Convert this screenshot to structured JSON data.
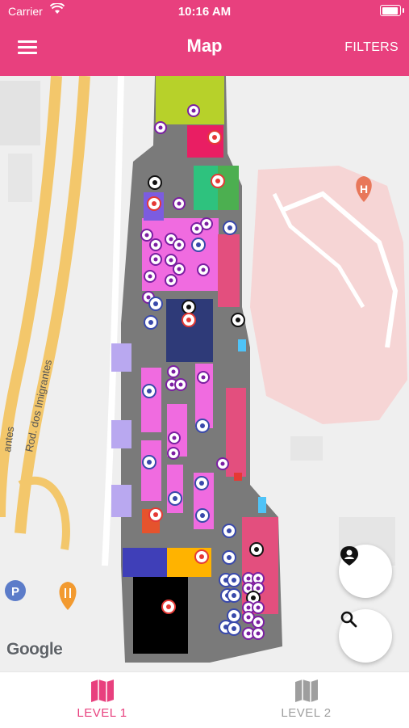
{
  "status_bar": {
    "carrier": "Carrier",
    "time": "10:16 AM"
  },
  "header": {
    "title": "Map",
    "filters_label": "FILTERS",
    "background": "#E8407E"
  },
  "map": {
    "road_label": "Rod. dos Imigrantes",
    "road_label_partial": "antes",
    "attribution": "Google",
    "hospital_marker_letter": "H",
    "parking_marker_letter": "P"
  },
  "buttons": {
    "profile_icon": "person-pin-icon",
    "search_icon": "search-icon"
  },
  "tabs": [
    {
      "label": "LEVEL 1",
      "icon": "map-icon",
      "active": true,
      "color": "#E8407E"
    },
    {
      "label": "LEVEL 2",
      "icon": "map-icon",
      "active": false,
      "color": "#9E9E9E"
    }
  ]
}
